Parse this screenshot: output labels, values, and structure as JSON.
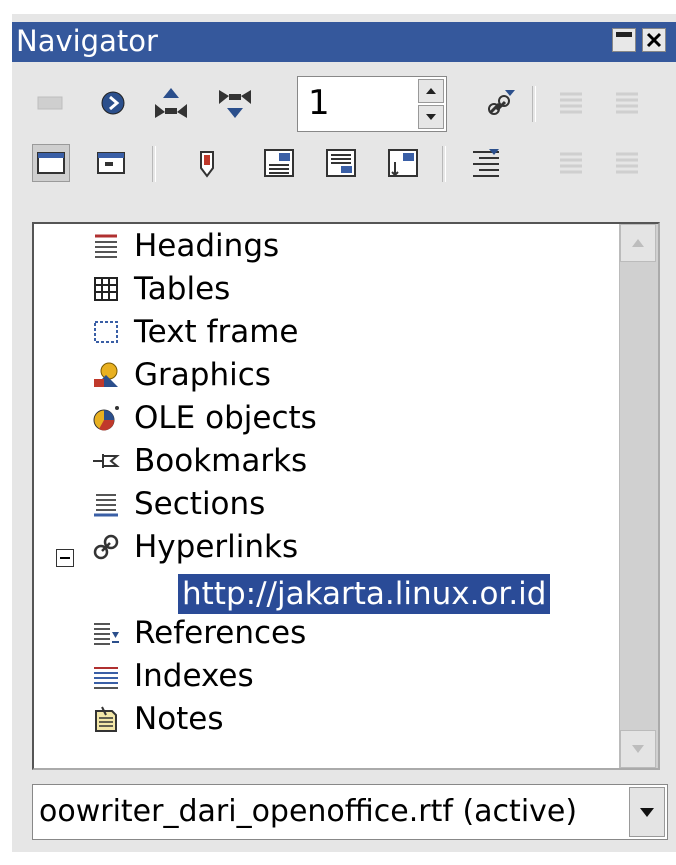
{
  "window": {
    "title": "Navigator"
  },
  "toolbar": {
    "page_number": "1"
  },
  "tree": {
    "items": [
      {
        "label": "Headings",
        "icon": "headings-icon"
      },
      {
        "label": "Tables",
        "icon": "table-icon"
      },
      {
        "label": "Text frame",
        "icon": "text-frame-icon"
      },
      {
        "label": "Graphics",
        "icon": "graphics-icon"
      },
      {
        "label": "OLE objects",
        "icon": "ole-objects-icon"
      },
      {
        "label": "Bookmarks",
        "icon": "bookmark-icon"
      },
      {
        "label": "Sections",
        "icon": "sections-icon"
      },
      {
        "label": "Hyperlinks",
        "icon": "hyperlink-icon",
        "expanded": true,
        "children": [
          {
            "label": "http://jakarta.linux.or.id",
            "selected": true
          }
        ]
      },
      {
        "label": "References",
        "icon": "references-icon"
      },
      {
        "label": "Indexes",
        "icon": "indexes-icon"
      },
      {
        "label": "Notes",
        "icon": "notes-icon"
      }
    ]
  },
  "document_selector": {
    "value": "oowriter_dari_openoffice.rtf (active)"
  },
  "colors": {
    "titlebar": "#35589c",
    "selection": "#2a4b97",
    "panel": "#e6e6e6"
  }
}
